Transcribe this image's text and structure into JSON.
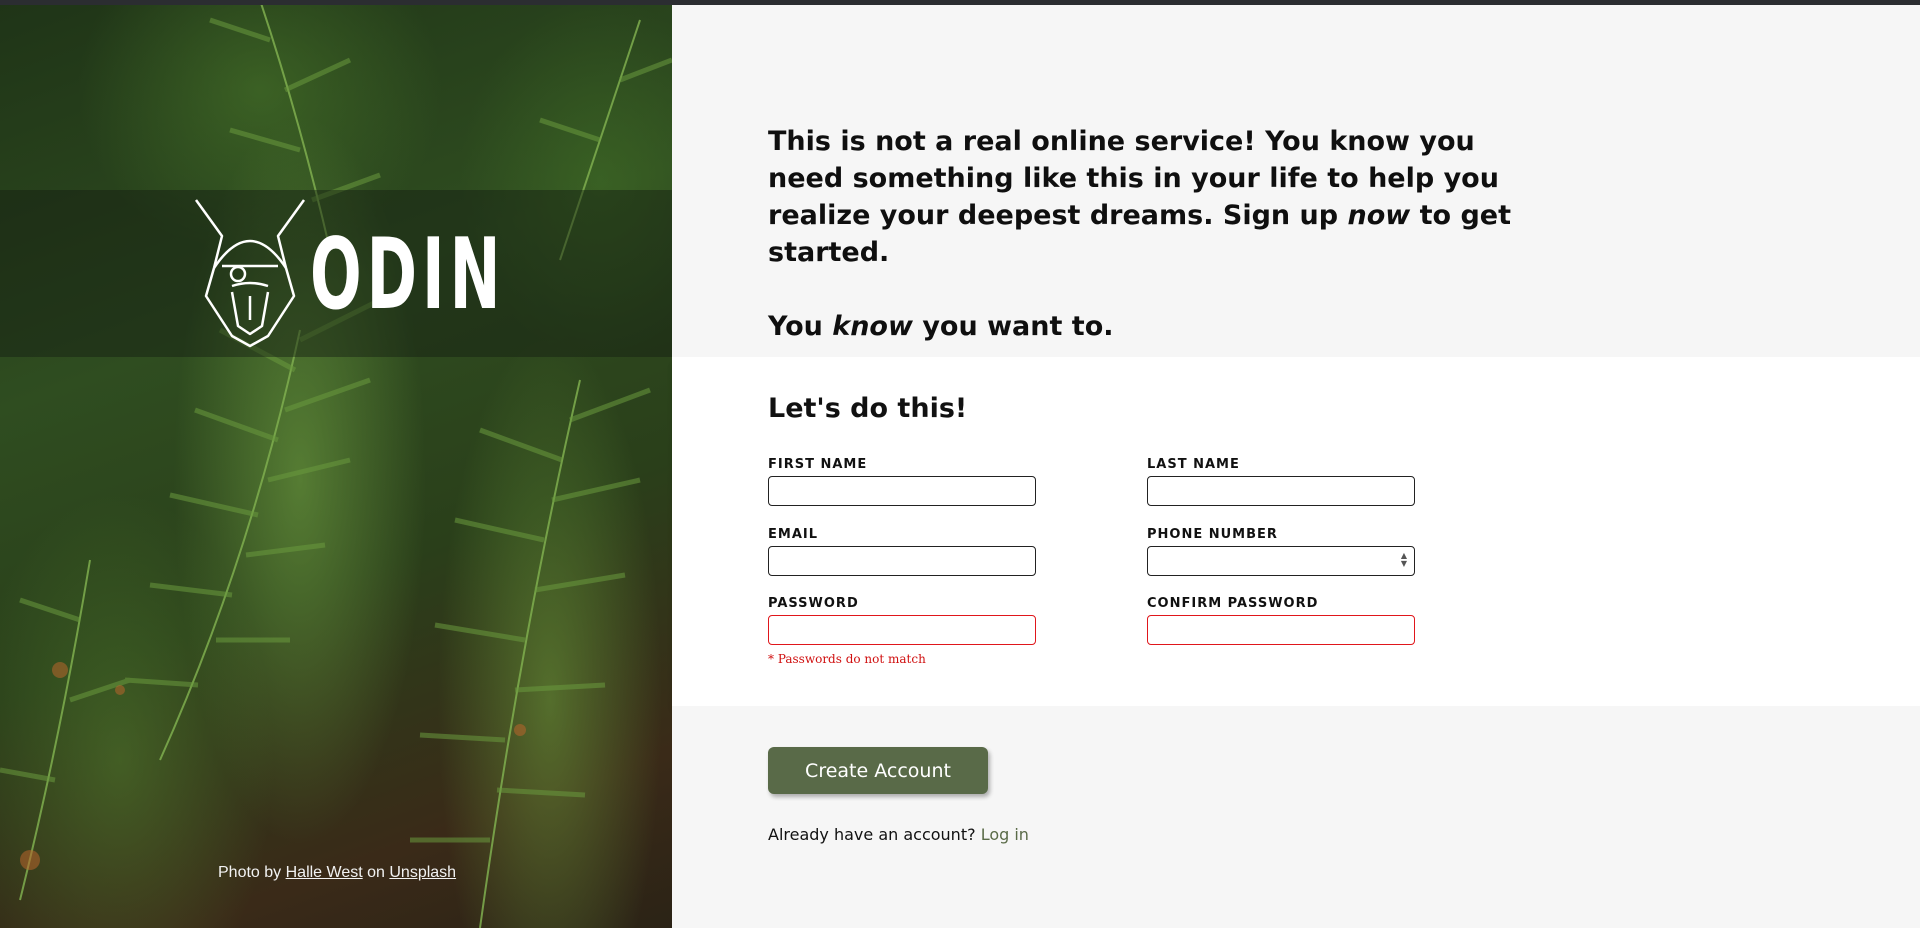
{
  "hero": {
    "logo_text": "ODIN",
    "credit": {
      "prefix": "Photo by",
      "author": "Halle West",
      "middle": "on",
      "source": "Unsplash"
    }
  },
  "intro": {
    "line1": "This is not a real online service! You know you need something like this in your life to help you realize your deepest dreams. Sign up ",
    "line1_emphasis": "now",
    "line1_end": " to get started.",
    "tagline_start": "You ",
    "tagline_emphasis": "know",
    "tagline_end": " you want to."
  },
  "form": {
    "title": "Let's do this!",
    "fields": {
      "first_name": {
        "label": "FIRST NAME",
        "value": ""
      },
      "last_name": {
        "label": "LAST NAME",
        "value": ""
      },
      "email": {
        "label": "EMAIL",
        "value": ""
      },
      "phone": {
        "label": "PHONE NUMBER",
        "value": ""
      },
      "password": {
        "label": "PASSWORD",
        "value": ""
      },
      "confirm_password": {
        "label": "CONFIRM PASSWORD",
        "value": ""
      }
    },
    "error_message": "* Passwords do not match"
  },
  "actions": {
    "submit_label": "Create Account",
    "login_prompt": "Already have an account?",
    "login_link": "Log in"
  },
  "colors": {
    "accent": "#596a48",
    "error": "#e0161b",
    "link": "#5a6b48"
  }
}
